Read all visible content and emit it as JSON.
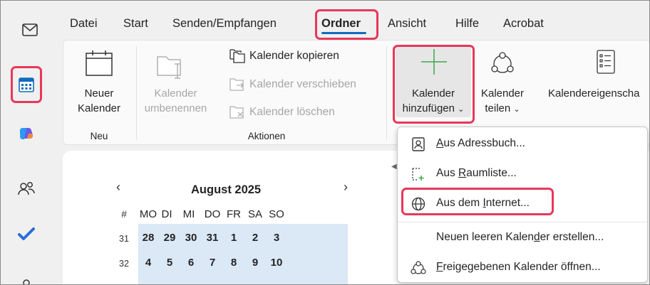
{
  "menu": {
    "items": [
      "Datei",
      "Start",
      "Senden/Empfangen",
      "Ordner",
      "Ansicht",
      "Hilfe",
      "Acrobat"
    ],
    "active": "Ordner"
  },
  "ribbon": {
    "new_calendar": {
      "line1": "Neuer",
      "line2": "Kalender"
    },
    "group_new": "Neu",
    "rename_calendar": {
      "line1": "Kalender",
      "line2": "umbenennen"
    },
    "copy_calendar": "Kalender kopieren",
    "move_calendar": "Kalender verschieben",
    "delete_calendar": "Kalender löschen",
    "group_actions": "Aktionen",
    "add_calendar": {
      "line1": "Kalender",
      "line2": "hinzufügen"
    },
    "share_calendar": {
      "line1": "Kalender",
      "line2": "teilen"
    },
    "calendar_properties": "Kalendereigenscha"
  },
  "calendar": {
    "month_title": "August 2025",
    "prev": "‹",
    "next": "›",
    "week_header": "#",
    "weekdays": [
      "MO",
      "DI",
      "MI",
      "DO",
      "FR",
      "SA",
      "SO"
    ],
    "weeks": [
      {
        "num": "31",
        "days": [
          "28",
          "29",
          "30",
          "31",
          "1",
          "2",
          "3"
        ]
      },
      {
        "num": "32",
        "days": [
          "4",
          "5",
          "6",
          "7",
          "8",
          "9",
          "10"
        ]
      }
    ]
  },
  "dropdown": {
    "items": [
      {
        "pre": "",
        "u": "A",
        "post": "us Adressbuch...",
        "icon": "address-book-icon"
      },
      {
        "pre": "Aus ",
        "u": "R",
        "post": "aumliste...",
        "icon": "room-list-icon"
      },
      {
        "pre": "Aus dem ",
        "u": "I",
        "post": "nternet...",
        "icon": "globe-icon"
      },
      {
        "pre": "Neuen leeren Kalen",
        "u": "d",
        "post": "er erstellen...",
        "icon": ""
      },
      {
        "pre": "",
        "u": "F",
        "post": "reigegebenen Kalender öffnen...",
        "icon": "shared-calendar-icon"
      }
    ]
  },
  "colors": {
    "highlight": "#e8375a",
    "accent": "#0f6cbd",
    "add_plus": "#3daa4c"
  }
}
